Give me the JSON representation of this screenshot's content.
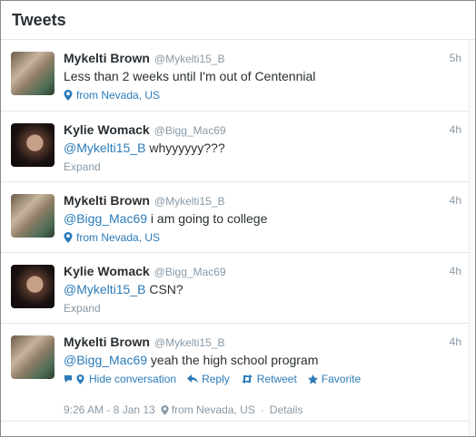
{
  "header": {
    "title": "Tweets"
  },
  "tweets": [
    {
      "fullname": "Mykelti Brown",
      "username": "@Mykelti15_B",
      "time": "5h",
      "mention": "",
      "text": "Less than 2 weeks until I'm out of Centennial",
      "location": "from Nevada, US"
    },
    {
      "fullname": "Kylie Womack",
      "username": "@Bigg_Mac69",
      "time": "4h",
      "mention": "@Mykelti15_B",
      "text": " whyyyyyy???",
      "expand": "Expand"
    },
    {
      "fullname": "Mykelti Brown",
      "username": "@Mykelti15_B",
      "time": "4h",
      "mention": "@Bigg_Mac69",
      "text": " i am going to college",
      "location": "from Nevada, US"
    },
    {
      "fullname": "Kylie Womack",
      "username": "@Bigg_Mac69",
      "time": "4h",
      "mention": "@Mykelti15_B",
      "text": " CSN?",
      "expand": "Expand"
    },
    {
      "fullname": "Mykelti Brown",
      "username": "@Mykelti15_B",
      "time": "4h",
      "mention": "@Bigg_Mac69",
      "text": " yeah the high school program",
      "actions": {
        "hide": "Hide conversation",
        "reply": "Reply",
        "retweet": "Retweet",
        "favorite": "Favorite"
      },
      "details": {
        "timestamp": "9:26 AM - 8 Jan 13",
        "location": "from Nevada, US",
        "details_link": "Details",
        "separator": "·"
      }
    }
  ],
  "colors": {
    "link": "#2b7bb9",
    "muted": "#8899a6",
    "text": "#292f33"
  }
}
